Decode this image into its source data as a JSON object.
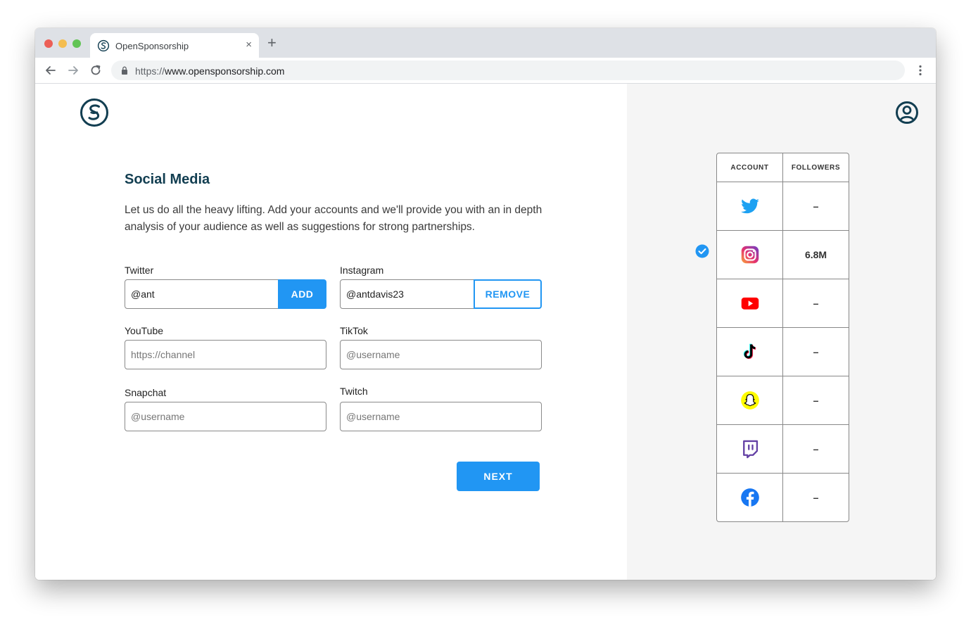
{
  "browser": {
    "tab_title": "OpenSponsorship",
    "tab_close": "×",
    "new_tab": "+",
    "url_scheme": "https://",
    "url_host": "www.opensponsorship.com"
  },
  "page": {
    "heading": "Social Media",
    "intro": "Let us do all the heavy lifting. Add your accounts and we'll provide you with an in depth analysis of your audience as well as suggestions for strong partnerships.",
    "fields": {
      "twitter": {
        "label": "Twitter",
        "value": "@ant",
        "button": "ADD"
      },
      "instagram": {
        "label": "Instagram",
        "value": "@antdavis23",
        "button": "REMOVE"
      },
      "youtube": {
        "label": "YouTube",
        "placeholder": "https://channel"
      },
      "tiktok": {
        "label": "TikTok",
        "placeholder": "@username"
      },
      "snapchat": {
        "label": "Snapchat",
        "placeholder": "@username"
      },
      "twitch": {
        "label": "Twitch",
        "placeholder": "@username"
      }
    },
    "next_button": "NEXT"
  },
  "accounts_table": {
    "headers": {
      "account": "ACCOUNT",
      "followers": "FOLLOWERS"
    },
    "rows": [
      {
        "icon": "twitter-icon",
        "followers": "–"
      },
      {
        "icon": "instagram-icon",
        "followers": "6.8M",
        "verified": true
      },
      {
        "icon": "youtube-icon",
        "followers": "–"
      },
      {
        "icon": "tiktok-icon",
        "followers": "–"
      },
      {
        "icon": "snapchat-icon",
        "followers": "–"
      },
      {
        "icon": "twitch-icon",
        "followers": "–"
      },
      {
        "icon": "facebook-icon",
        "followers": "–"
      }
    ]
  },
  "colors": {
    "brand_dark": "#123e51",
    "accent_blue": "#2196f3",
    "right_pane_bg": "#f5f5f5"
  }
}
